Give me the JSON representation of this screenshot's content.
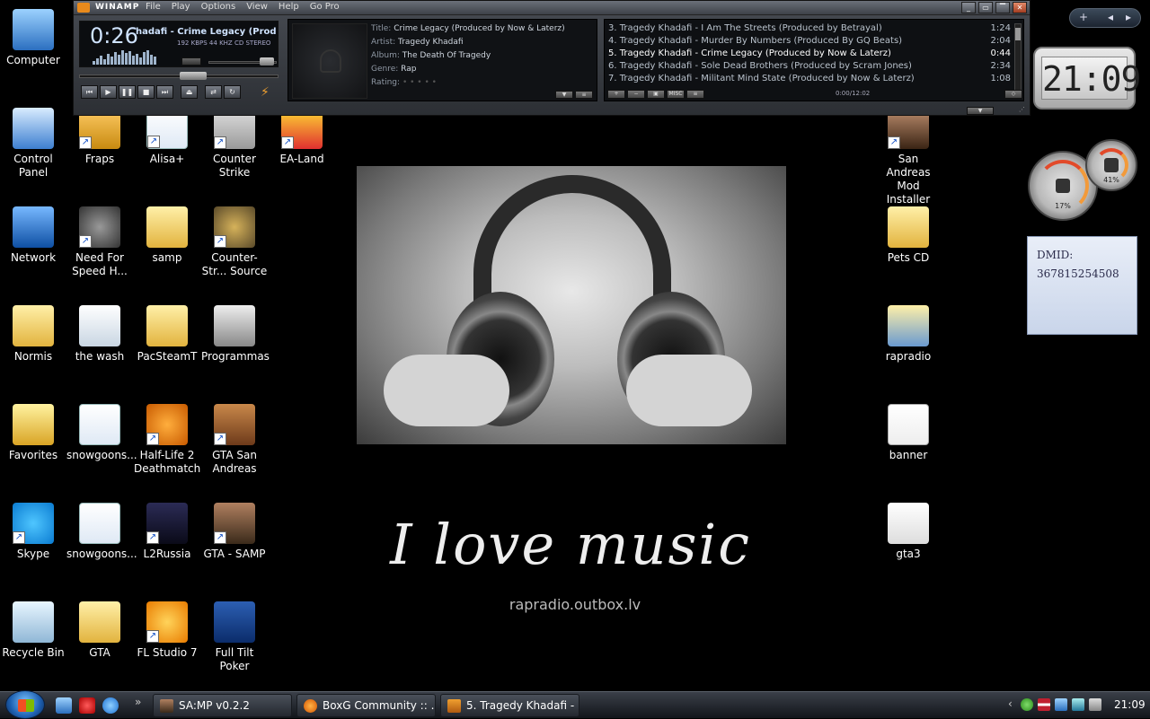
{
  "desktop": {
    "wallpaper": {
      "slogan": "I love music",
      "url": "rapradio.outbox.lv"
    },
    "icons": [
      {
        "label": "Computer",
        "icon": "computer-icon",
        "name": "desktop-icon-computer"
      },
      {
        "label": "Control Panel",
        "icon": "control-panel-icon",
        "name": "desktop-icon-control-panel"
      },
      {
        "label": "Network",
        "icon": "network-icon",
        "name": "desktop-icon-network"
      },
      {
        "label": "Normis",
        "icon": "folder-icon",
        "name": "desktop-icon-normis"
      },
      {
        "label": "Favorites",
        "icon": "star-folder-icon",
        "name": "desktop-icon-favorites"
      },
      {
        "label": "Skype",
        "icon": "skype-icon",
        "name": "desktop-icon-skype"
      },
      {
        "label": "Recycle Bin",
        "icon": "recycle-bin-icon",
        "name": "desktop-icon-recycle-bin"
      },
      {
        "label": "Fraps",
        "icon": "fraps-icon",
        "name": "desktop-icon-fraps"
      },
      {
        "label": "Need For Speed H...",
        "icon": "nfs-icon",
        "name": "desktop-icon-need-for-speed"
      },
      {
        "label": "the wash",
        "icon": "film-icon",
        "name": "desktop-icon-the-wash"
      },
      {
        "label": "snowgoons...",
        "icon": "document-icon",
        "name": "desktop-icon-snowgoons-1"
      },
      {
        "label": "snowgoons...",
        "icon": "document-icon",
        "name": "desktop-icon-snowgoons-2"
      },
      {
        "label": "GTA",
        "icon": "folder-icon",
        "name": "desktop-icon-gta"
      },
      {
        "label": "Alisa+",
        "icon": "document-icon",
        "name": "desktop-icon-alisa"
      },
      {
        "label": "samp",
        "icon": "folder-icon",
        "name": "desktop-icon-samp"
      },
      {
        "label": "PacSteamT",
        "icon": "folder-icon",
        "name": "desktop-icon-pacsteamt"
      },
      {
        "label": "Half-Life 2 Deathmatch",
        "icon": "half-life-icon",
        "name": "desktop-icon-half-life"
      },
      {
        "label": "L2Russia",
        "icon": "l2-icon",
        "name": "desktop-icon-l2russia"
      },
      {
        "label": "FL Studio 7",
        "icon": "fl-studio-icon",
        "name": "desktop-icon-fl-studio"
      },
      {
        "label": "Counter Strike",
        "icon": "counter-strike-icon",
        "name": "desktop-icon-counter-strike"
      },
      {
        "label": "Counter-Str... Source",
        "icon": "cs-source-icon",
        "name": "desktop-icon-cs-source"
      },
      {
        "label": "Programmas",
        "icon": "programs-icon",
        "name": "desktop-icon-programmas"
      },
      {
        "label": "GTA San Andreas",
        "icon": "gta-sa-icon",
        "name": "desktop-icon-gta-san-andreas"
      },
      {
        "label": "GTA - SAMP",
        "icon": "gta-samp-icon",
        "name": "desktop-icon-gta-samp"
      },
      {
        "label": "Full Tilt Poker",
        "icon": "poker-icon",
        "name": "desktop-icon-full-tilt-poker"
      },
      {
        "label": "EA-Land",
        "icon": "ea-land-icon",
        "name": "desktop-icon-ea-land"
      },
      {
        "label": "San Andreas Mod Installer",
        "icon": "sa-mod-icon",
        "name": "desktop-icon-sa-mod-installer"
      },
      {
        "label": "Pets CD",
        "icon": "folder-icon",
        "name": "desktop-icon-pets-cd"
      },
      {
        "label": "rapradio",
        "icon": "music-folder-icon",
        "name": "desktop-icon-rapradio"
      },
      {
        "label": "banner",
        "icon": "image-icon",
        "name": "desktop-icon-banner"
      },
      {
        "label": "gta3",
        "icon": "image-icon",
        "name": "desktop-icon-gta3"
      }
    ]
  },
  "winamp": {
    "brand": "WINAMP",
    "menu": [
      "File",
      "Play",
      "Options",
      "View",
      "Help",
      "Go Pro"
    ],
    "time": "0:26",
    "scroll_title": "hadafi - Crime Legacy (Produced",
    "bitrate": "192",
    "bitrate_unit": "KBPS",
    "samplerate": "44",
    "samplerate_unit": "KHZ",
    "channel_mode": "CD",
    "stereo": "STEREO",
    "info": {
      "title_label": "Title:",
      "title": "Crime Legacy (Produced by Now & Laterz)",
      "artist_label": "Artist:",
      "artist": "Tragedy Khadafi",
      "album_label": "Album:",
      "album": "The Death Of Tragedy",
      "genre_label": "Genre:",
      "genre": "Rap",
      "rating_label": "Rating:",
      "rating_dots": "• • • • •"
    },
    "playlist": [
      {
        "title": "3. Tragedy Khadafi - I Am The Streets (Produced by Betrayal)",
        "length": "1:24"
      },
      {
        "title": "4. Tragedy Khadafi - Murder By Numbers (Produced By GQ Beats)",
        "length": "2:04"
      },
      {
        "title": "5. Tragedy Khadafi - Crime Legacy (Produced by Now & Laterz)",
        "length": "0:44"
      },
      {
        "title": "6. Tragedy Khadafi - Sole Dead Brothers (Produced by Scram Jones)",
        "length": "2:34"
      },
      {
        "title": "7. Tragedy Khadafi - Militant Mind State (Produced by Now & Laterz)",
        "length": "1:08"
      }
    ],
    "playlist_time": "0:00/12:02",
    "playlist_misc": "MISC"
  },
  "sidebar": {
    "add": "+",
    "clock_time": "21:09",
    "cpu_gauge": "17%",
    "mem_gauge": "41%",
    "note_label": "DMID:",
    "note_value": "367815254508"
  },
  "taskbar": {
    "quick_more": "»",
    "tasks": [
      {
        "label": "SA:MP v0.2.2",
        "name": "task-samp"
      },
      {
        "label": "BoxG Community :: ...",
        "name": "task-boxg"
      },
      {
        "label": "5. Tragedy Khadafi - ...",
        "name": "task-winamp"
      }
    ],
    "tray_arrow": "‹",
    "clock": "21:09"
  }
}
